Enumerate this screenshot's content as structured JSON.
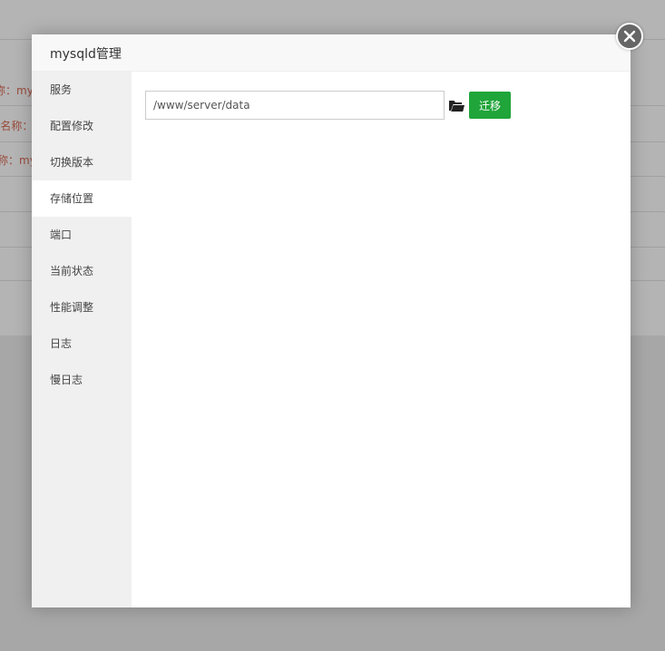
{
  "background": {
    "snippets": [
      "称：mys",
      "-名称：",
      "称：my"
    ]
  },
  "modal": {
    "title": "mysqld管理",
    "close_icon": "close-icon"
  },
  "sidebar": {
    "items": [
      {
        "label": "服务"
      },
      {
        "label": "配置修改"
      },
      {
        "label": "切换版本"
      },
      {
        "label": "存储位置",
        "active": true
      },
      {
        "label": "端口"
      },
      {
        "label": "当前状态"
      },
      {
        "label": "性能调整"
      },
      {
        "label": "日志"
      },
      {
        "label": "慢日志"
      }
    ]
  },
  "storage": {
    "path_value": "/www/server/data",
    "folder_icon": "folder-open-icon",
    "migrate_label": "迁移",
    "accent": "#20a53a"
  }
}
